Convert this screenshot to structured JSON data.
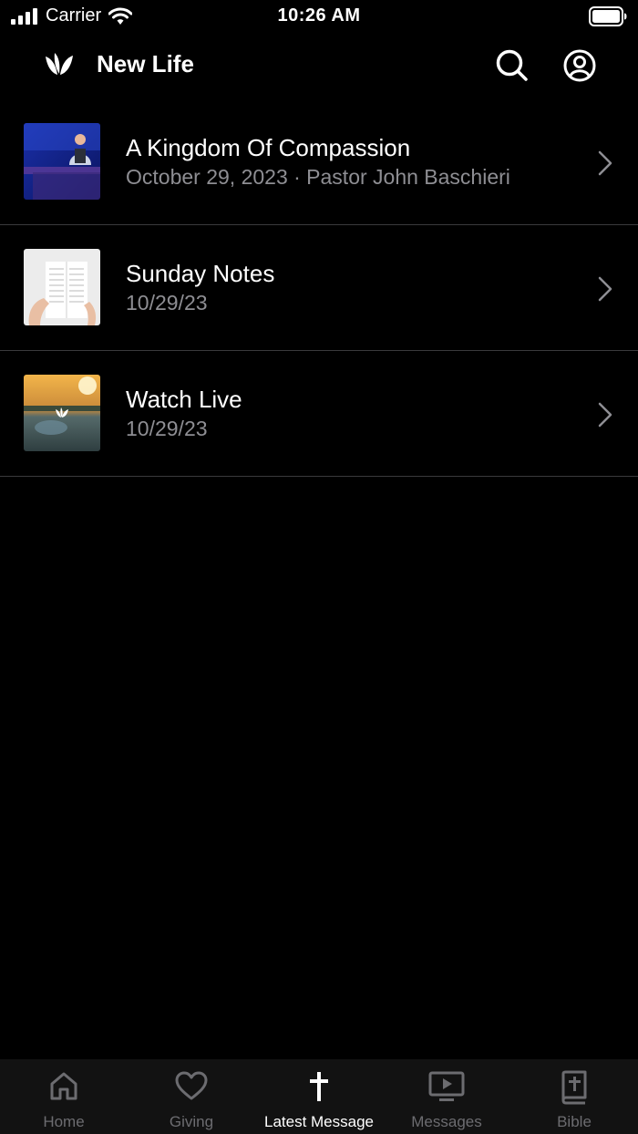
{
  "status_bar": {
    "carrier": "Carrier",
    "time": "10:26 AM"
  },
  "header": {
    "title": "New Life"
  },
  "items": [
    {
      "title": "A Kingdom Of Compassion",
      "subtitle": "October 29, 2023 · Pastor John Baschieri"
    },
    {
      "title": "Sunday Notes",
      "subtitle": "10/29/23"
    },
    {
      "title": "Watch Live",
      "subtitle": "10/29/23"
    }
  ],
  "tabs": [
    {
      "label": "Home",
      "icon": "home-icon"
    },
    {
      "label": "Giving",
      "icon": "heart-icon"
    },
    {
      "label": "Latest Message",
      "icon": "cross-icon",
      "active": true
    },
    {
      "label": "Messages",
      "icon": "tv-play-icon"
    },
    {
      "label": "Bible",
      "icon": "bible-icon"
    }
  ],
  "colors": {
    "background": "#000000",
    "secondary_text": "#8e8e93",
    "separator": "#3a3a3c",
    "tab_inactive": "#6c6c70",
    "tab_active": "#ffffff"
  }
}
